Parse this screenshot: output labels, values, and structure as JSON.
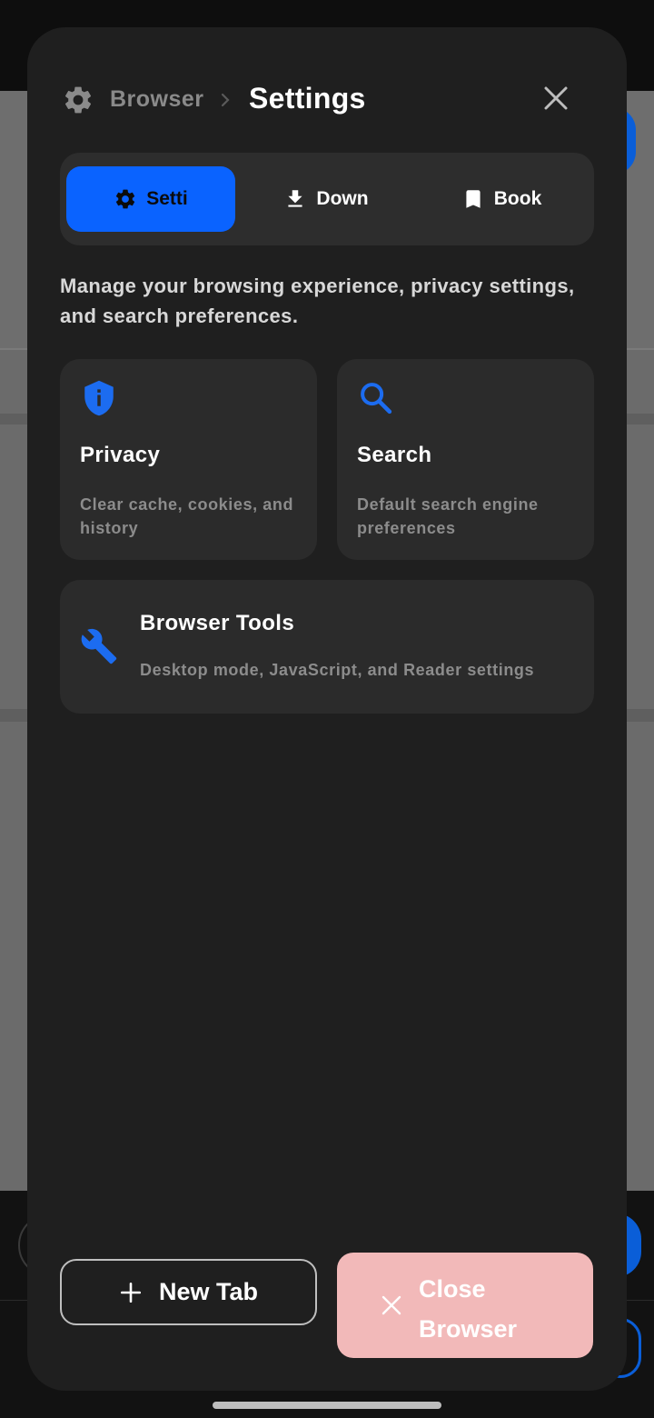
{
  "header": {
    "breadcrumb": "Browser",
    "title": "Settings"
  },
  "tabs": [
    {
      "label": "Setti",
      "icon": "gear-icon",
      "active": true
    },
    {
      "label": "Down",
      "icon": "download-icon",
      "active": false
    },
    {
      "label": "Book",
      "icon": "bookmark-icon",
      "active": false
    }
  ],
  "description": "Manage your browsing experience, privacy settings, and search preferences.",
  "cards": {
    "privacy": {
      "title": "Privacy",
      "subtitle": "Clear cache, cookies, and history",
      "icon": "shield-info-icon"
    },
    "search": {
      "title": "Search",
      "subtitle": "Default search engine preferences",
      "icon": "search-icon"
    },
    "tools": {
      "title": "Browser Tools",
      "subtitle": "Desktop mode, JavaScript, and Reader settings",
      "icon": "wrench-icon"
    }
  },
  "actions": {
    "new_tab": "New Tab",
    "close_browser": "Close Browser"
  },
  "colors": {
    "accent": "#0a63ff",
    "modal_bg": "#1f1f1f",
    "card_bg": "#2b2b2b",
    "danger_muted": "#f2b9b9"
  }
}
